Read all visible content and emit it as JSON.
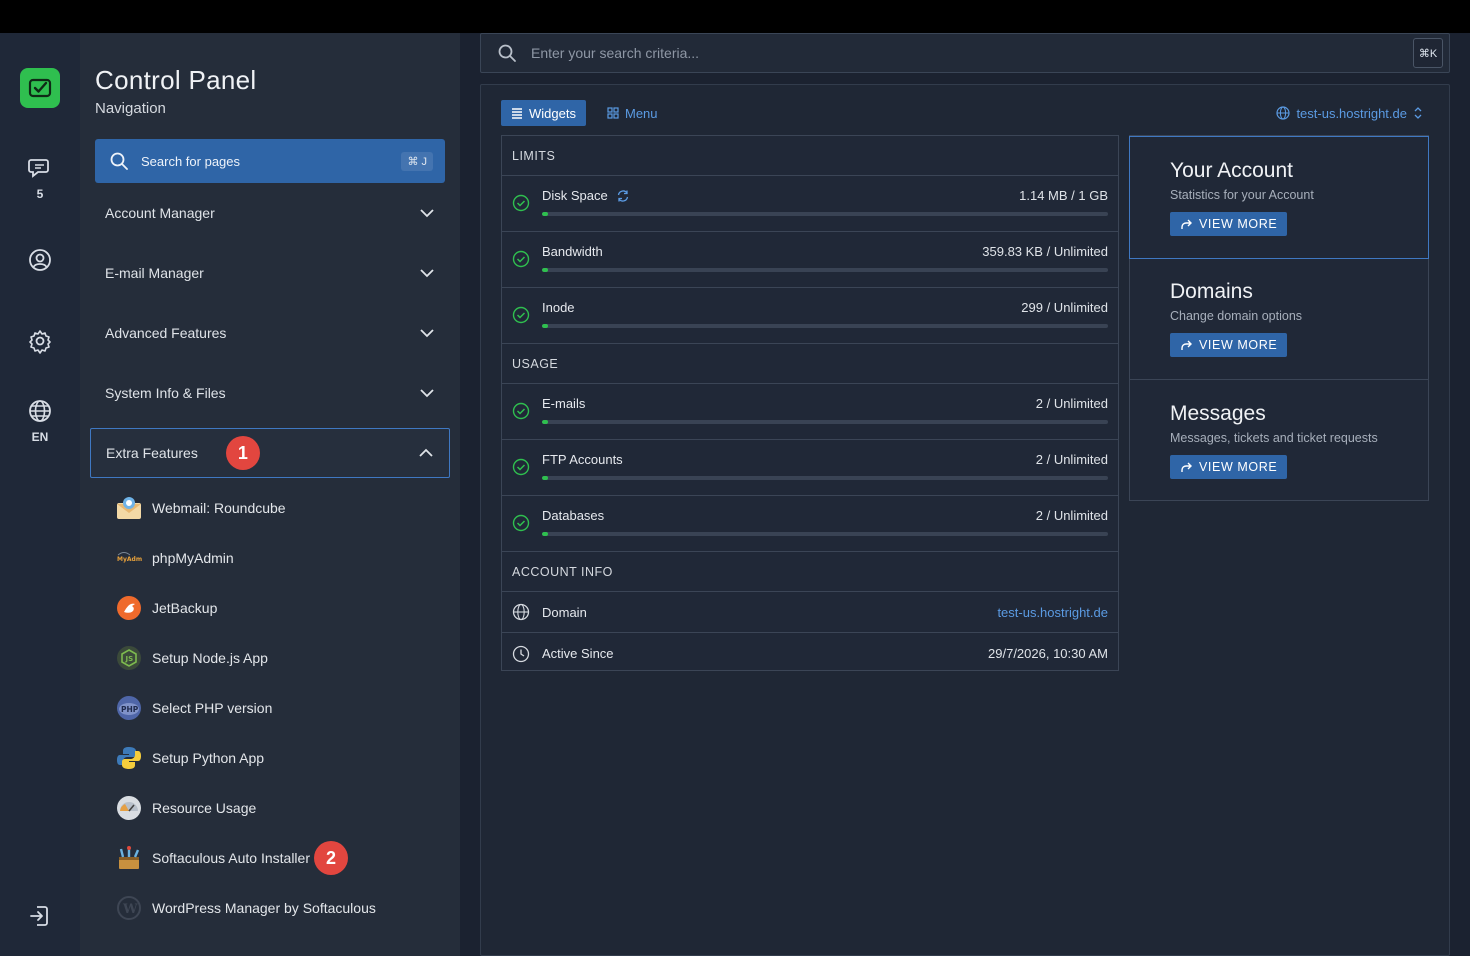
{
  "rail": {
    "messages_count": "5",
    "language": "EN"
  },
  "nav": {
    "title": "Control Panel",
    "subtitle": "Navigation",
    "search_label": "Search for pages",
    "search_shortcut": "⌘ J",
    "sections": [
      {
        "label": "Account Manager"
      },
      {
        "label": "E-mail Manager"
      },
      {
        "label": "Advanced Features"
      },
      {
        "label": "System Info & Files"
      },
      {
        "label": "Extra Features",
        "badge": "1"
      }
    ],
    "extra_items": [
      {
        "label": "Webmail: Roundcube",
        "icon": "roundcube-icon"
      },
      {
        "label": "phpMyAdmin",
        "icon": "phpmyadmin-icon"
      },
      {
        "label": "JetBackup",
        "icon": "jetbackup-icon"
      },
      {
        "label": "Setup Node.js App",
        "icon": "nodejs-icon"
      },
      {
        "label": "Select PHP version",
        "icon": "php-icon"
      },
      {
        "label": "Setup Python App",
        "icon": "python-icon"
      },
      {
        "label": "Resource Usage",
        "icon": "resource-usage-icon"
      },
      {
        "label": "Softaculous Auto Installer",
        "icon": "softaculous-icon",
        "badge": "2"
      },
      {
        "label": "WordPress Manager by Softaculous",
        "icon": "wordpress-icon"
      }
    ]
  },
  "search": {
    "placeholder": "Enter your search criteria...",
    "shortcut": "⌘K"
  },
  "tabs": {
    "widgets": "Widgets",
    "menu": "Menu"
  },
  "domain_selector": "test-us.hostright.de",
  "limits": {
    "heading": "LIMITS",
    "rows": [
      {
        "label": "Disk Space",
        "value": "1.14 MB / 1 GB",
        "fill": 0.01
      },
      {
        "label": "Bandwidth",
        "value": "359.83 KB / Unlimited",
        "fill": 0.01
      },
      {
        "label": "Inode",
        "value": "299 / Unlimited",
        "fill": 0.01
      }
    ]
  },
  "usage": {
    "heading": "USAGE",
    "rows": [
      {
        "label": "E-mails",
        "value": "2 / Unlimited",
        "fill": 0.01
      },
      {
        "label": "FTP Accounts",
        "value": "2 / Unlimited",
        "fill": 0.01
      },
      {
        "label": "Databases",
        "value": "2 / Unlimited",
        "fill": 0.01
      }
    ]
  },
  "account_info": {
    "heading": "ACCOUNT INFO",
    "domain_label": "Domain",
    "domain_value": "test-us.hostright.de",
    "active_label": "Active Since",
    "active_value": "29/7/2026, 10:30 AM"
  },
  "side_cards": [
    {
      "title": "Your Account",
      "subtitle": "Statistics for your Account",
      "button": "VIEW MORE"
    },
    {
      "title": "Domains",
      "subtitle": "Change domain options",
      "button": "VIEW MORE"
    },
    {
      "title": "Messages",
      "subtitle": "Messages, tickets and ticket requests",
      "button": "VIEW MORE"
    }
  ],
  "colors": {
    "accent": "#2f65a7",
    "link": "#5b9be3",
    "success": "#2fbf4f",
    "badge": "#e2463f"
  }
}
